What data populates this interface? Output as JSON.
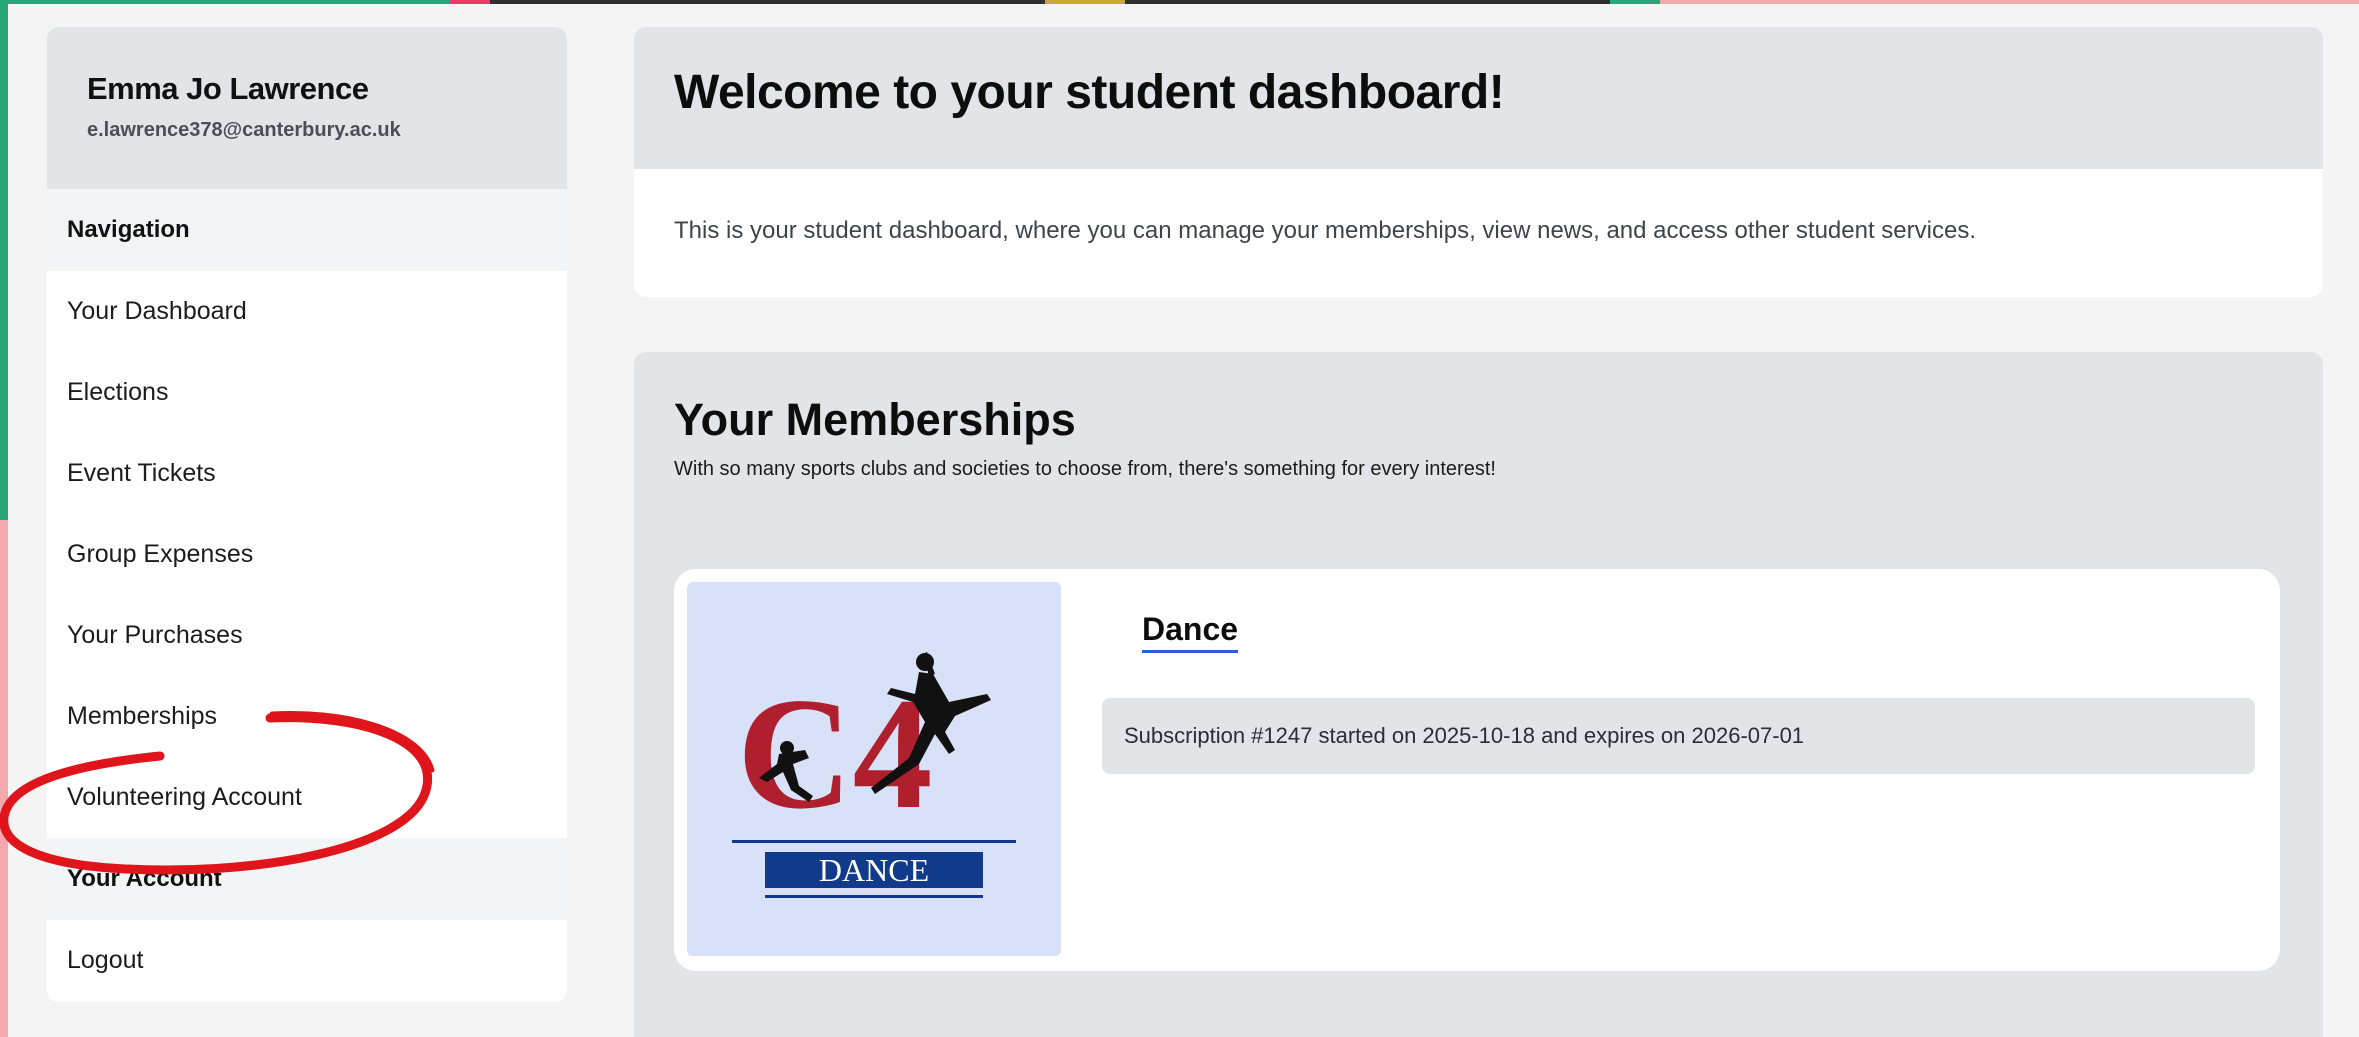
{
  "user": {
    "name": "Emma Jo Lawrence",
    "email": "e.lawrence378@canterbury.ac.uk"
  },
  "navigation": {
    "heading": "Navigation",
    "items": [
      {
        "label": "Your Dashboard"
      },
      {
        "label": "Elections"
      },
      {
        "label": "Event Tickets"
      },
      {
        "label": "Group Expenses"
      },
      {
        "label": "Your Purchases"
      },
      {
        "label": "Memberships"
      },
      {
        "label": "Volunteering Account"
      }
    ]
  },
  "account": {
    "heading": "Your Account",
    "items": [
      {
        "label": "Logout"
      }
    ]
  },
  "welcome": {
    "title": "Welcome to your student dashboard!",
    "text": "This is your student dashboard, where you can manage your memberships, view news, and access other student services."
  },
  "memberships": {
    "title": "Your Memberships",
    "subtitle": "With so many sports clubs and societies to choose from, there's something for every interest!",
    "items": [
      {
        "club": "Dance",
        "logo_text_big": "C4",
        "logo_text_banner": "DANCE",
        "subscription": "Subscription #1247 started on 2025-10-18 and expires on 2026-07-01"
      }
    ]
  },
  "colors": {
    "annotation": "#e0151b",
    "logo_red": "#b01f2e",
    "logo_navy": "#123a8a"
  },
  "icons": {
    "annotation": "red-circle-annotation",
    "logo_dancer": "dancer-silhouette"
  }
}
